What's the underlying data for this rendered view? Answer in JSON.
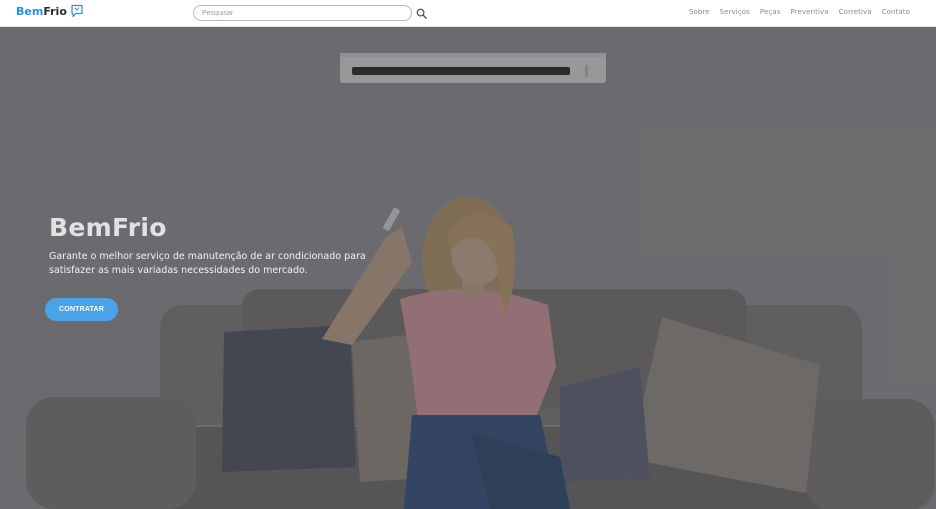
{
  "header": {
    "logo_bem": "Bem",
    "logo_frio": "Frio",
    "search_placeholder": "Pesquisar",
    "nav": [
      "Sobre",
      "Serviços",
      "Peças",
      "Preventiva",
      "Corretiva",
      "Contato"
    ]
  },
  "hero": {
    "title": "BemFrio",
    "subtitle": "Garante o melhor serviço de manutenção de ar condicionado para satisfazer as mais variadas necessidades do mercado.",
    "cta_label": "CONTRATAR"
  },
  "colors": {
    "brand_blue": "#2f8fdb",
    "cta_blue": "#4aa3e8"
  }
}
